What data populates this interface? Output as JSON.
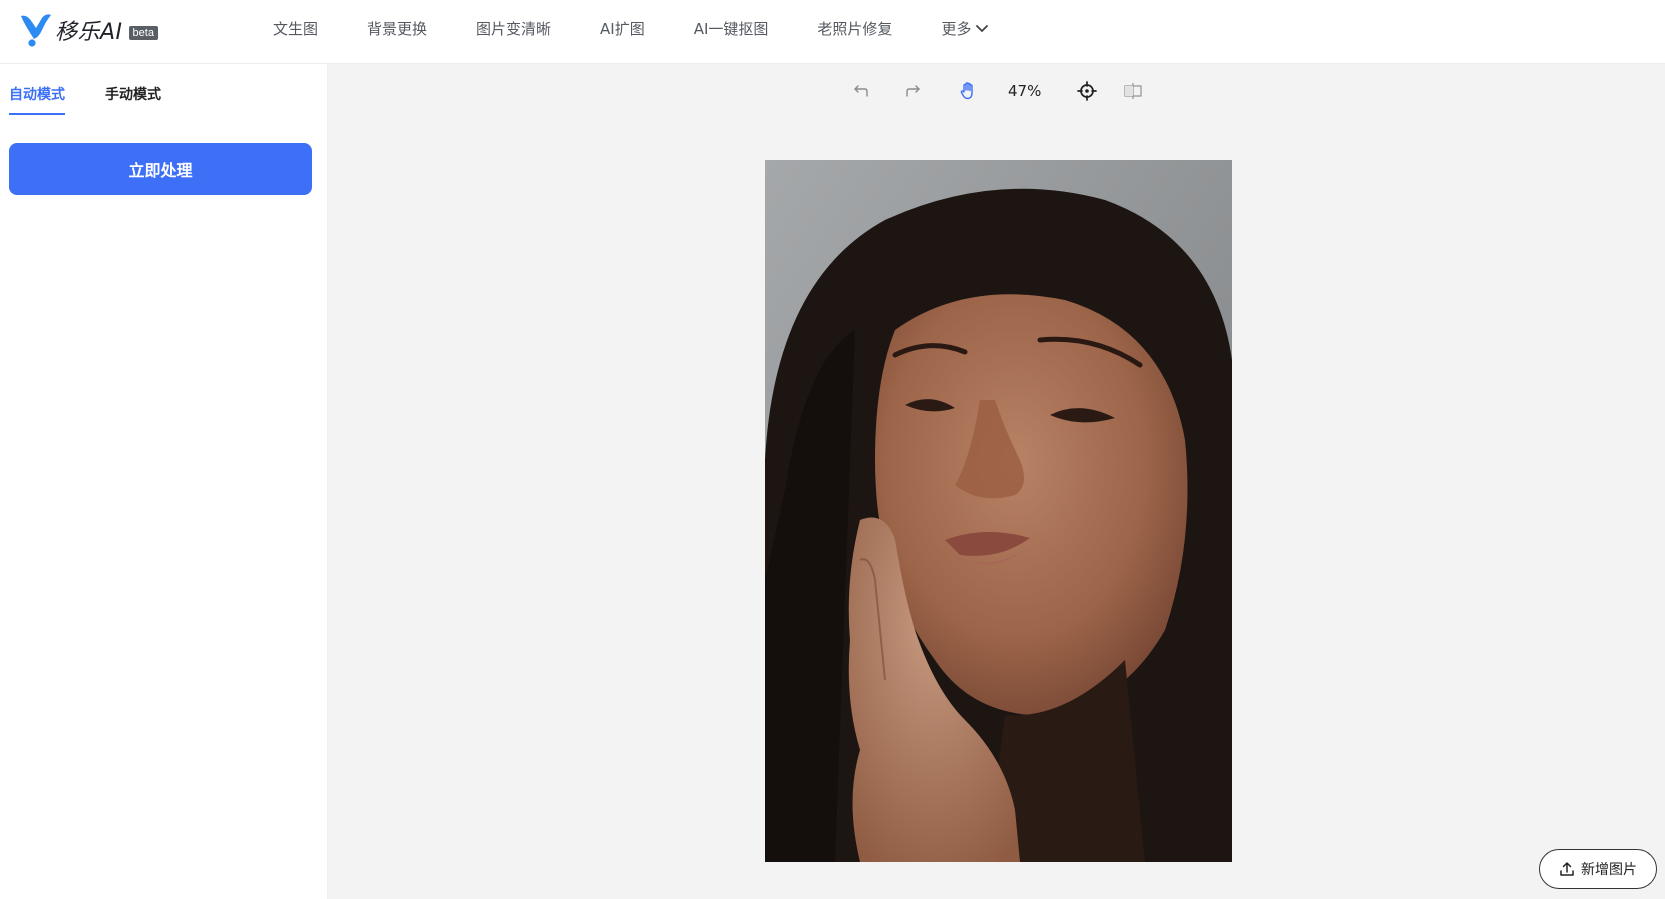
{
  "brand": {
    "name": "移乐AI",
    "badge": "beta",
    "accent": "#1f8bf4"
  },
  "nav": {
    "items": [
      "文生图",
      "背景更换",
      "图片变清晰",
      "AI扩图",
      "AI一键抠图",
      "老照片修复",
      "更多"
    ]
  },
  "sidebar": {
    "tabs": [
      {
        "label": "自动模式",
        "active": true
      },
      {
        "label": "手动模式",
        "active": false
      }
    ],
    "process_button": "立即处理",
    "accent": "#3d6ff7"
  },
  "toolbar": {
    "zoom": "47%",
    "icons": [
      "undo-icon",
      "redo-icon",
      "hand-icon",
      "crosshair-icon",
      "compare-icon"
    ]
  },
  "canvas": {
    "image_alt": "portrait photo",
    "upload_button": "新增图片"
  }
}
